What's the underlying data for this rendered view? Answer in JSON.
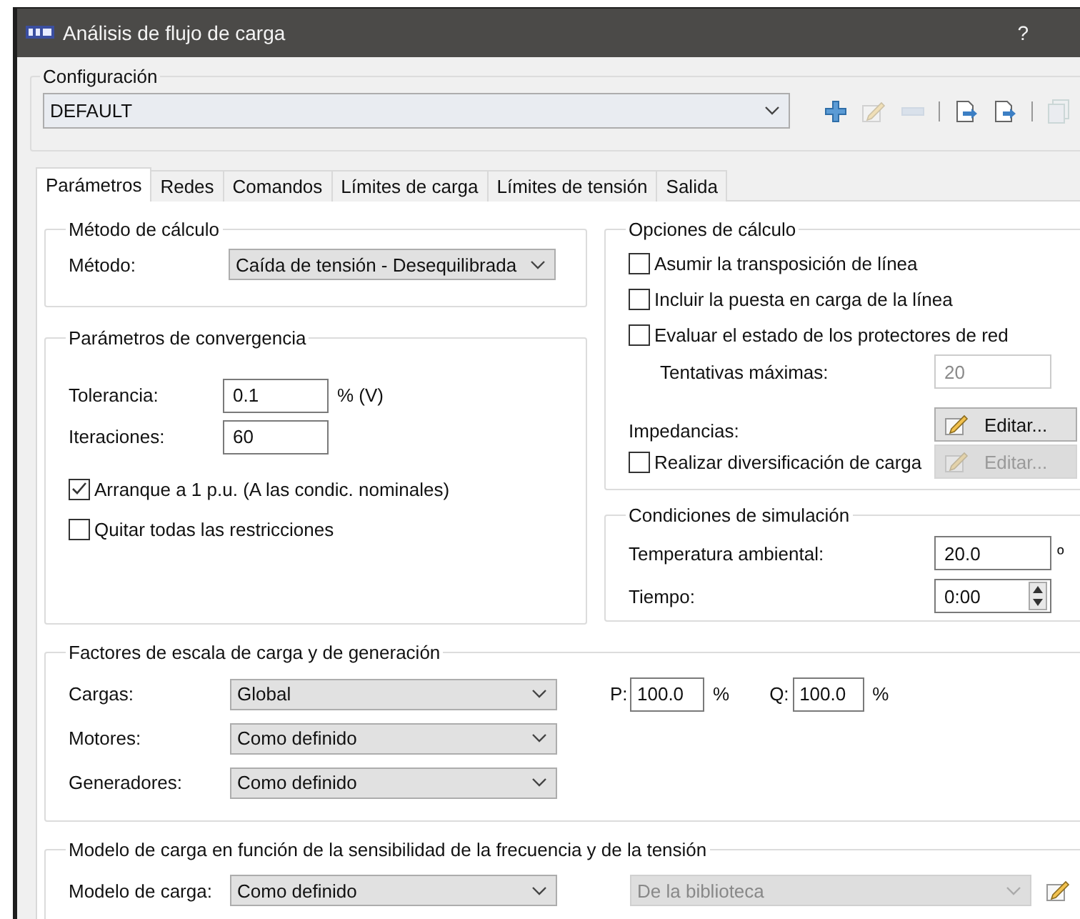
{
  "window": {
    "title": "Análisis de flujo de carga",
    "help": "?"
  },
  "configuration": {
    "title": "Configuración",
    "value": "DEFAULT",
    "toolbar": [
      {
        "kind": "add",
        "disabled": false
      },
      {
        "kind": "edit",
        "disabled": true
      },
      {
        "kind": "remove",
        "disabled": true
      },
      {
        "kind": "separator"
      },
      {
        "kind": "import",
        "disabled": false
      },
      {
        "kind": "export",
        "disabled": false
      },
      {
        "kind": "separator"
      },
      {
        "kind": "copy",
        "disabled": true
      }
    ]
  },
  "tabs": [
    {
      "label": "Parámetros",
      "selected": true
    },
    {
      "label": "Redes",
      "selected": false
    },
    {
      "label": "Comandos",
      "selected": false
    },
    {
      "label": "Límites de carga",
      "selected": false
    },
    {
      "label": "Límites de tensión",
      "selected": false
    },
    {
      "label": "Salida",
      "selected": false
    }
  ],
  "calc_method": {
    "title": "Método de cálculo",
    "label": "Método:",
    "value": "Caída de tensión - Desequilibrada"
  },
  "convergence": {
    "title": "Parámetros de convergencia",
    "fields": [
      {
        "label": "Tolerancia:",
        "value": "0.1",
        "unit": "% (V)"
      },
      {
        "label": "Iteraciones:",
        "value": "60"
      }
    ],
    "checkboxes": [
      {
        "label": "Arranque a 1 p.u. (A las condic. nominales)",
        "checked": true
      },
      {
        "label": "Quitar todas las restricciones",
        "checked": false
      }
    ]
  },
  "calc_options": {
    "title": "Opciones de cálculo",
    "rows": [
      {
        "kind": "checkbox",
        "label": "Asumir la transposición de línea",
        "checked": false
      },
      {
        "kind": "checkbox",
        "label": "Incluir la puesta en carga de la línea",
        "checked": false
      },
      {
        "kind": "checkbox",
        "label": "Evaluar el estado de los protectores de red",
        "checked": false
      },
      {
        "kind": "field",
        "label": "Tentativas máximas:",
        "value": "20",
        "disabled": true
      },
      {
        "kind": "button",
        "label": "Impedancias:",
        "button": "Editar...",
        "disabled": false
      },
      {
        "kind": "checkbox_button",
        "label": "Realizar diversificación de carga",
        "checked": false,
        "button": "Editar...",
        "disabled": true
      }
    ]
  },
  "simulation": {
    "title": "Condiciones de simulación",
    "rows": [
      {
        "kind": "field",
        "label": "Temperatura ambiental:",
        "value": "20.0",
        "unit": "º"
      },
      {
        "kind": "spinner",
        "label": "Tiempo:",
        "value": "0:00"
      }
    ]
  },
  "scale_factors": {
    "title": "Factores de escala de carga y de generación",
    "rows": [
      {
        "label": "Cargas:",
        "value": "Global"
      },
      {
        "label": "Motores:",
        "value": "Como definido"
      },
      {
        "label": "Generadores:",
        "value": "Como definido"
      }
    ],
    "p": {
      "label": "P:",
      "value": "100.0",
      "unit": "%"
    },
    "q": {
      "label": "Q:",
      "value": "100.0",
      "unit": "%"
    }
  },
  "load_model": {
    "title": "Modelo de carga en función de la sensibilidad de la frecuencia y de la tensión",
    "label": "Modelo de carga:",
    "value": "Como definido",
    "library": {
      "value": "De la biblioteca",
      "disabled": true
    }
  }
}
